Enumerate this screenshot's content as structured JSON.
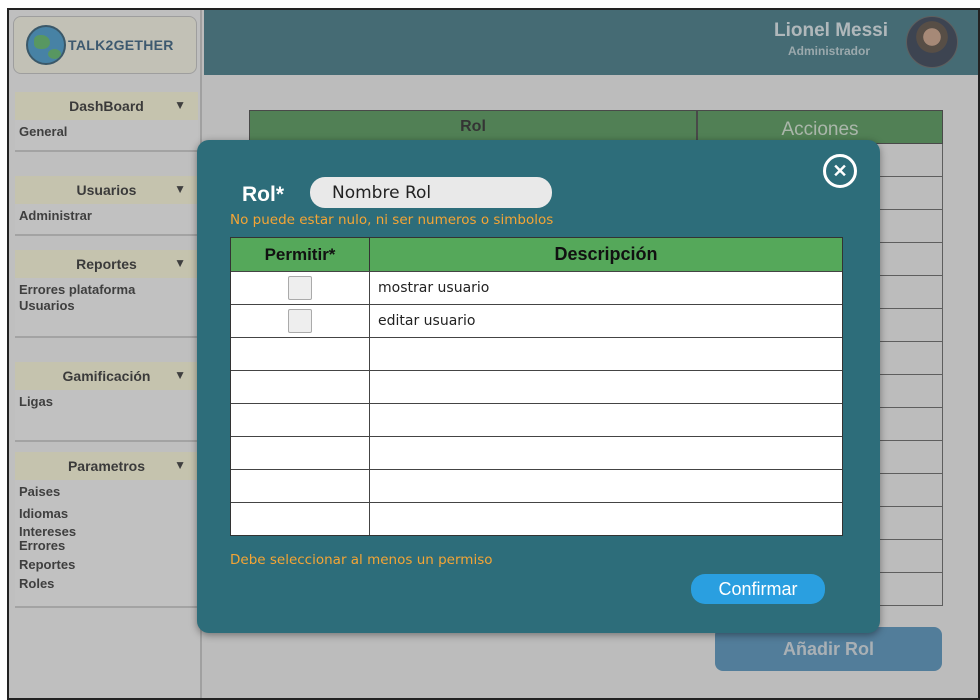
{
  "app": {
    "logo_text": "TALK2GETHER"
  },
  "user": {
    "name": "Lionel Messi",
    "role": "Administrador"
  },
  "sidebar": {
    "sections": [
      {
        "title": "DashBoard",
        "items": [
          "General"
        ]
      },
      {
        "title": "Usuarios",
        "items": [
          "Administrar"
        ]
      },
      {
        "title": "Reportes",
        "items": [
          "Errores plataforma",
          "Usuarios"
        ]
      },
      {
        "title": "Gamificación",
        "items": [
          "Ligas"
        ]
      },
      {
        "title": "Parametros",
        "items": [
          "Paises",
          "Idiomas",
          "Intereses",
          "Errores",
          "Reportes",
          "Roles"
        ]
      }
    ]
  },
  "background_table": {
    "col_rol": "Rol",
    "col_acciones": "Acciones"
  },
  "add_rol_button": "Añadir Rol",
  "modal": {
    "rol_label": "Rol*",
    "rol_placeholder": "Nombre Rol",
    "rol_error": "No puede estar nulo, ni ser numeros o simbolos",
    "col_permitir": "Permitir*",
    "col_descripcion": "Descripción",
    "rows": [
      {
        "checkbox": true,
        "description": "mostrar usuario"
      },
      {
        "checkbox": true,
        "description": "editar usuario"
      },
      {
        "checkbox": false,
        "description": ""
      },
      {
        "checkbox": false,
        "description": ""
      },
      {
        "checkbox": false,
        "description": ""
      },
      {
        "checkbox": false,
        "description": ""
      },
      {
        "checkbox": false,
        "description": ""
      },
      {
        "checkbox": false,
        "description": ""
      }
    ],
    "permission_error": "Debe seleccionar al menos un permiso",
    "confirm_label": "Confirmar",
    "close_icon": "close-icon"
  }
}
